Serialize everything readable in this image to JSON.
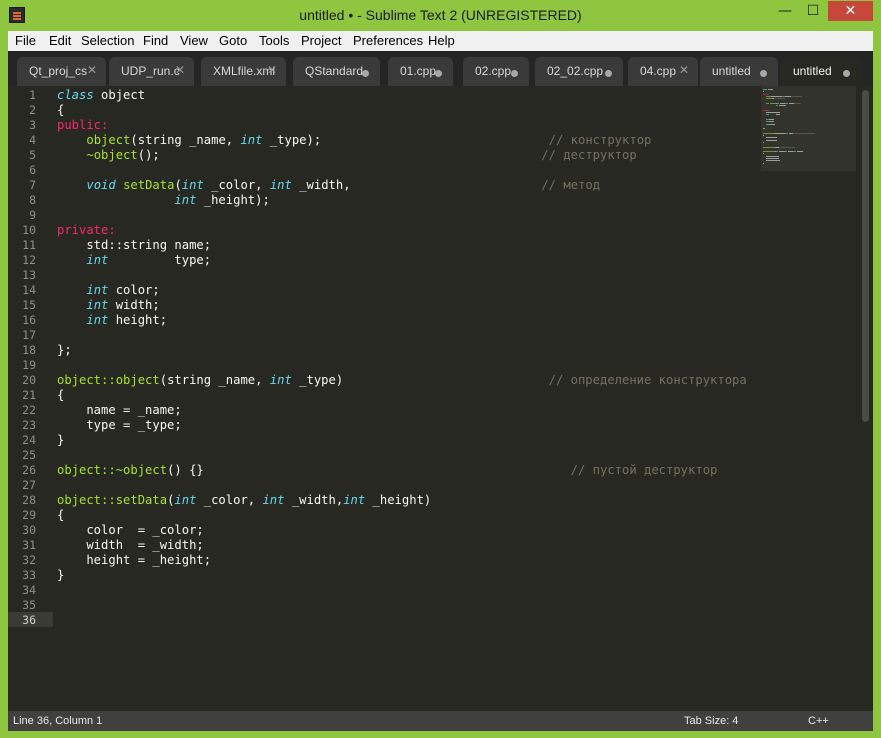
{
  "window": {
    "title": "untitled • - Sublime Text 2 (UNREGISTERED)",
    "minimize": "—",
    "maximize": "☐",
    "close": "✕"
  },
  "menu": [
    "File",
    "Edit",
    "Selection",
    "Find",
    "View",
    "Goto",
    "Tools",
    "Project",
    "Preferences",
    "Help"
  ],
  "tabs": [
    {
      "label": "Qt_proj_cs",
      "state": "close"
    },
    {
      "label": "UDP_run.c",
      "state": "close"
    },
    {
      "label": "XMLfile.xml",
      "state": "close"
    },
    {
      "label": "QStandard",
      "state": "dirty"
    },
    {
      "label": "01.cpp",
      "state": "dirty"
    },
    {
      "label": "02.cpp",
      "state": "dirty"
    },
    {
      "label": "02_02.cpp",
      "state": "dirty"
    },
    {
      "label": "04.cpp",
      "state": "close"
    },
    {
      "label": "untitled",
      "state": "dirty"
    },
    {
      "label": "untitled",
      "state": "dirty",
      "active": true
    }
  ],
  "code": [
    [
      [
        "kw",
        "class"
      ],
      [
        "t",
        " object"
      ]
    ],
    [
      [
        "t",
        "{"
      ]
    ],
    [
      [
        "ac",
        "public:"
      ]
    ],
    [
      [
        "t",
        "    "
      ],
      [
        "fn",
        "object"
      ],
      [
        "t",
        "(string _name, "
      ],
      [
        "kw",
        "int"
      ],
      [
        "t",
        " _type);                               "
      ],
      [
        "cm",
        "// конструктор"
      ]
    ],
    [
      [
        "t",
        "    "
      ],
      [
        "fn",
        "~object"
      ],
      [
        "t",
        "();                                                    "
      ],
      [
        "cm",
        "// деструктор"
      ]
    ],
    [
      [
        "t",
        ""
      ]
    ],
    [
      [
        "t",
        "    "
      ],
      [
        "kw",
        "void"
      ],
      [
        "t",
        " "
      ],
      [
        "fn",
        "setData"
      ],
      [
        "t",
        "("
      ],
      [
        "kw",
        "int"
      ],
      [
        "t",
        " _color, "
      ],
      [
        "kw",
        "int"
      ],
      [
        "t",
        " _width,                          "
      ],
      [
        "cm",
        "// метод"
      ]
    ],
    [
      [
        "t",
        "                "
      ],
      [
        "kw",
        "int"
      ],
      [
        "t",
        " _height);"
      ]
    ],
    [
      [
        "t",
        ""
      ]
    ],
    [
      [
        "ac",
        "private:"
      ]
    ],
    [
      [
        "t",
        "    std::string name;"
      ]
    ],
    [
      [
        "t",
        "    "
      ],
      [
        "kw",
        "int"
      ],
      [
        "t",
        "         type;"
      ]
    ],
    [
      [
        "t",
        ""
      ]
    ],
    [
      [
        "t",
        "    "
      ],
      [
        "kw",
        "int"
      ],
      [
        "t",
        " color;"
      ]
    ],
    [
      [
        "t",
        "    "
      ],
      [
        "kw",
        "int"
      ],
      [
        "t",
        " width;"
      ]
    ],
    [
      [
        "t",
        "    "
      ],
      [
        "kw",
        "int"
      ],
      [
        "t",
        " height;"
      ]
    ],
    [
      [
        "t",
        ""
      ]
    ],
    [
      [
        "t",
        "};"
      ]
    ],
    [
      [
        "t",
        ""
      ]
    ],
    [
      [
        "fn",
        "object::object"
      ],
      [
        "t",
        "(string _name, "
      ],
      [
        "kw",
        "int"
      ],
      [
        "t",
        " _type)                            "
      ],
      [
        "cm",
        "// определение конструктора"
      ]
    ],
    [
      [
        "t",
        "{"
      ]
    ],
    [
      [
        "t",
        "    name = _name;"
      ]
    ],
    [
      [
        "t",
        "    type = _type;"
      ]
    ],
    [
      [
        "t",
        "}"
      ]
    ],
    [
      [
        "t",
        ""
      ]
    ],
    [
      [
        "fn",
        "object::~object"
      ],
      [
        "t",
        "() {}                                                  "
      ],
      [
        "cm",
        "// пустой деструктор"
      ]
    ],
    [
      [
        "t",
        ""
      ]
    ],
    [
      [
        "fn",
        "object::setData"
      ],
      [
        "t",
        "("
      ],
      [
        "kw",
        "int"
      ],
      [
        "t",
        " _color, "
      ],
      [
        "kw",
        "int"
      ],
      [
        "t",
        " _width,"
      ],
      [
        "kw",
        "int"
      ],
      [
        "t",
        " _height)"
      ]
    ],
    [
      [
        "t",
        "{"
      ]
    ],
    [
      [
        "t",
        "    color  = _color;"
      ]
    ],
    [
      [
        "t",
        "    width  = _width;"
      ]
    ],
    [
      [
        "t",
        "    height = _height;"
      ]
    ],
    [
      [
        "t",
        "}"
      ]
    ],
    [
      [
        "t",
        ""
      ]
    ],
    [
      [
        "t",
        ""
      ]
    ],
    [
      [
        "t",
        ""
      ]
    ]
  ],
  "status": {
    "position": "Line 36, Column 1",
    "tab_size": "Tab Size: 4",
    "syntax": "C++"
  },
  "colors": {
    "keyword": "#66d9ef",
    "function": "#a6e22e",
    "access": "#f92672",
    "comment": "#75715e",
    "text": "#f8f8f2",
    "background": "#272822",
    "frame": "#8ec63f"
  }
}
